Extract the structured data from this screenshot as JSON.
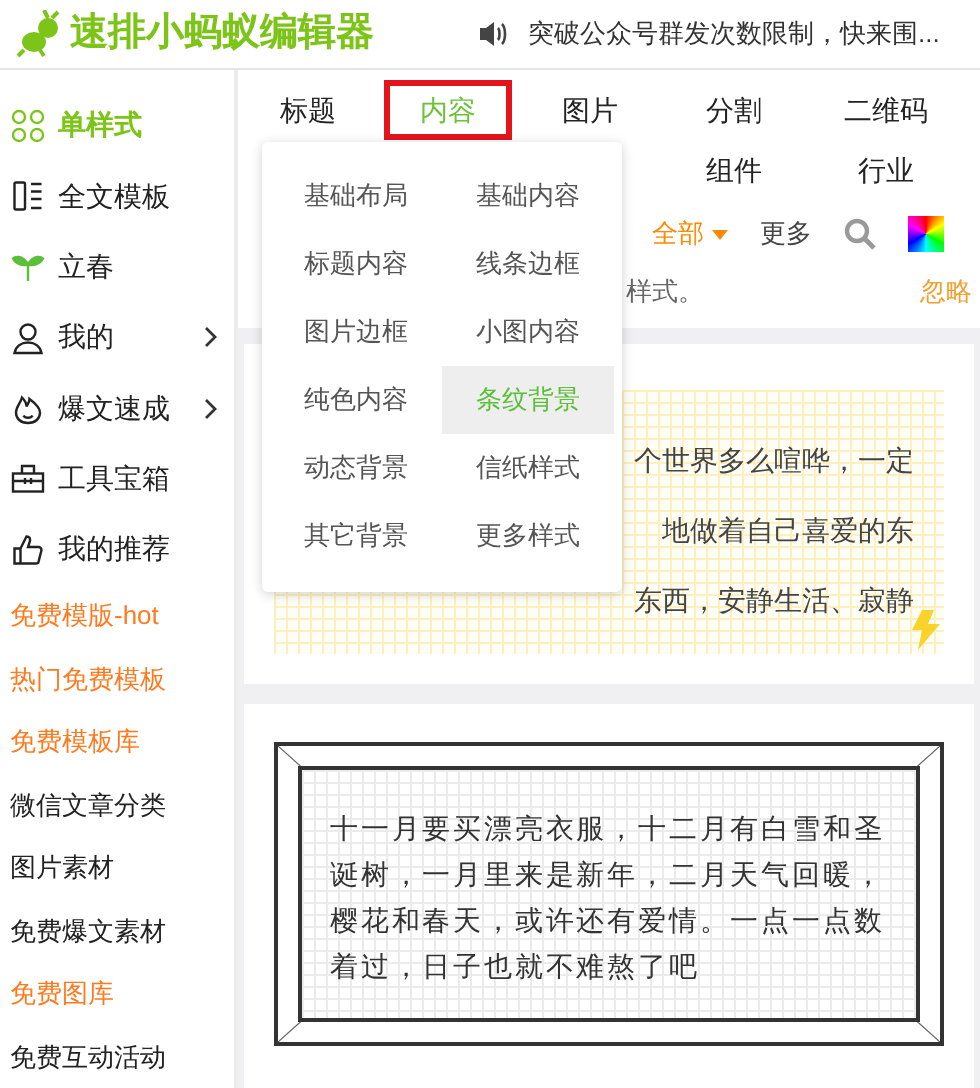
{
  "header": {
    "title": "速排小蚂蚁编辑器",
    "announcement": "突破公众号群发次数限制，快来围..."
  },
  "sidebar": {
    "items": [
      {
        "kind": "icon",
        "label": "单样式",
        "selected": true,
        "has_arrow": false
      },
      {
        "kind": "icon",
        "label": "全文模板",
        "selected": false,
        "has_arrow": false
      },
      {
        "kind": "icon",
        "label": "立春",
        "selected": false,
        "has_arrow": false
      },
      {
        "kind": "icon",
        "label": "我的",
        "selected": false,
        "has_arrow": true
      },
      {
        "kind": "icon",
        "label": "爆文速成",
        "selected": false,
        "has_arrow": true
      },
      {
        "kind": "icon",
        "label": "工具宝箱",
        "selected": false,
        "has_arrow": false
      },
      {
        "kind": "icon",
        "label": "我的推荐",
        "selected": false,
        "has_arrow": false
      },
      {
        "kind": "link",
        "label": "免费模版-hot",
        "hot": true
      },
      {
        "kind": "link",
        "label": "热门免费模板",
        "hot": true
      },
      {
        "kind": "link",
        "label": "免费模板库",
        "hot": true
      },
      {
        "kind": "link",
        "label": "微信文章分类",
        "hot": false
      },
      {
        "kind": "link",
        "label": "图片素材",
        "hot": false
      },
      {
        "kind": "link",
        "label": "免费爆文素材",
        "hot": false
      },
      {
        "kind": "link",
        "label": "免费图库",
        "hot": true
      },
      {
        "kind": "link",
        "label": "免费互动活动",
        "hot": false
      }
    ]
  },
  "tabs": [
    {
      "label": "标题",
      "selected": false
    },
    {
      "label": "内容",
      "selected": true
    },
    {
      "label": "图片",
      "selected": false
    },
    {
      "label": "分割",
      "selected": false
    },
    {
      "label": "二维码",
      "selected": false
    },
    {
      "label": "组件",
      "selected": false
    },
    {
      "label": "行业",
      "selected": false
    }
  ],
  "dropdown": {
    "items": [
      {
        "label": "基础布局",
        "selected": false
      },
      {
        "label": "基础内容",
        "selected": false
      },
      {
        "label": "标题内容",
        "selected": false
      },
      {
        "label": "线条边框",
        "selected": false
      },
      {
        "label": "图片边框",
        "selected": false
      },
      {
        "label": "小图内容",
        "selected": false
      },
      {
        "label": "纯色内容",
        "selected": false
      },
      {
        "label": "条纹背景",
        "selected": true
      },
      {
        "label": "动态背景",
        "selected": false
      },
      {
        "label": "信纸样式",
        "selected": false
      },
      {
        "label": "其它背景",
        "selected": false
      },
      {
        "label": "更多样式",
        "selected": false
      }
    ]
  },
  "toolbar": {
    "filter": "全部",
    "more": "更多"
  },
  "notice": {
    "text": "样式。",
    "dismiss": "忽略"
  },
  "cards": [
    {
      "kind": "grid",
      "lines": [
        "个世界多么喧哗，一定",
        "地做着自己喜爱的东",
        "东西，安静生活、寂静"
      ]
    },
    {
      "kind": "frame",
      "text": "十一月要买漂亮衣服，十二月有白雪和圣诞树，一月里来是新年，二月天气回暖，樱花和春天，或许还有爱情。一点一点数着过，日子也就不难熬了吧"
    }
  ]
}
